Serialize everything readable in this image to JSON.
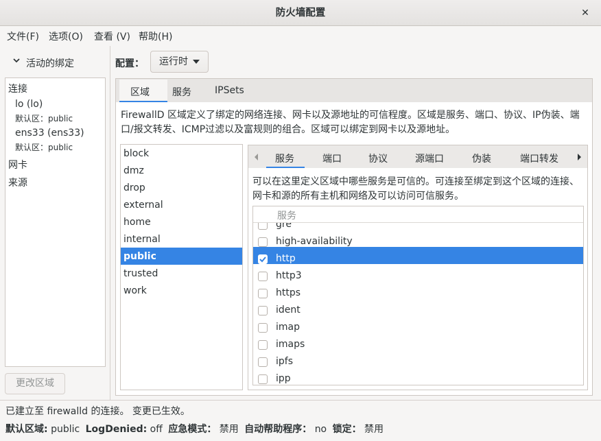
{
  "window": {
    "title": "防火墙配置"
  },
  "menu": [
    "文件(F)",
    "选项(O)",
    "查看 (V)",
    "帮助(H)"
  ],
  "sidebar": {
    "heading": "活动的绑定",
    "sections": {
      "connections": "连接",
      "conn1_name": "lo (lo)",
      "conn1_zone": "默认区：public",
      "conn2_name": "ens33 (ens33)",
      "conn2_zone": "默认区：public",
      "nic": "网卡",
      "source": "来源"
    },
    "change_zone_button": "更改区域"
  },
  "config": {
    "label": "配置：",
    "value": "运行时"
  },
  "tabs": [
    "区域",
    "服务",
    "IPSets"
  ],
  "zone_description": "FirewallD 区域定义了绑定的网络连接、网卡以及源地址的可信程度。区域是服务、端口、协议、IP伪装、端口/报文转发、ICMP过滤以及富规则的组合。区域可以绑定到网卡以及源地址。",
  "zones": [
    "block",
    "dmz",
    "drop",
    "external",
    "home",
    "internal",
    "public",
    "trusted",
    "work"
  ],
  "selected_zone": "public",
  "inner_tabs": [
    "服务",
    "端口",
    "协议",
    "源端口",
    "伪装",
    "端口转发"
  ],
  "services_description": "可以在这里定义区域中哪些服务是可信的。可连接至绑定到这个区域的连接、网卡和源的所有主机和网络及可以访问可信服务。",
  "services_header": "服务",
  "services": [
    {
      "name": "gre",
      "checked": false
    },
    {
      "name": "high-availability",
      "checked": false
    },
    {
      "name": "http",
      "checked": true
    },
    {
      "name": "http3",
      "checked": false
    },
    {
      "name": "https",
      "checked": false
    },
    {
      "name": "ident",
      "checked": false
    },
    {
      "name": "imap",
      "checked": false
    },
    {
      "name": "imaps",
      "checked": false
    },
    {
      "name": "ipfs",
      "checked": false
    },
    {
      "name": "ipp",
      "checked": false
    }
  ],
  "status": "已建立至 firewalld 的连接。 变更已生效。",
  "footer": {
    "default_zone_label": "默认区域:",
    "default_zone_value": "public",
    "logdenied_label": "LogDenied:",
    "logdenied_value": "off",
    "panic_label": "应急模式：",
    "panic_value": "禁用",
    "helper_label": "自动帮助程序：",
    "helper_value": "no",
    "lockdown_label": "锁定：",
    "lockdown_value": "禁用"
  },
  "colors": {
    "accent": "#3584e4"
  }
}
